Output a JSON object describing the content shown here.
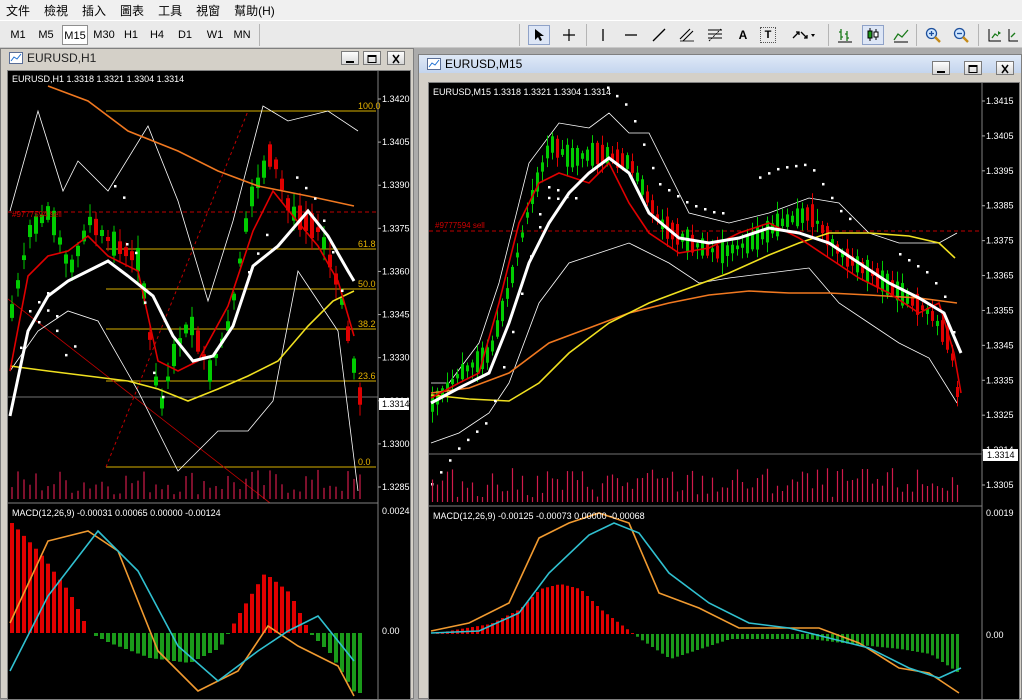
{
  "menu": [
    "文件",
    "檢視",
    "插入",
    "圖表",
    "工具",
    "視窗",
    "幫助(H)"
  ],
  "timeframes": [
    "M1",
    "M5",
    "M15",
    "M30",
    "H1",
    "H4",
    "D1",
    "W1",
    "MN"
  ],
  "active_timeframe": "M15",
  "toolbar_tools": [
    "cursor-arrow",
    "crosshair",
    "vertical-line",
    "horizontal-line",
    "trend-line",
    "equidistant-channel",
    "fibonacci",
    "text-label",
    "text-box",
    "arrows-menu",
    "bar-chart",
    "candlestick-chart",
    "line-chart",
    "zoom-in",
    "zoom-out",
    "chart-shift",
    "auto-scroll"
  ],
  "tools_text": {
    "text_label": "A",
    "text_box": "T"
  },
  "colors": {
    "up": "#00cc00",
    "down": "#e00000",
    "ma_white": "#ffffff",
    "ma_yellow": "#f0e020",
    "ma_orange": "#f07820",
    "ma_red": "#e00000",
    "macd_line": "#f09a30",
    "signal_line": "#30c0d0",
    "volume": "#d01a4a"
  },
  "windows": {
    "h1": {
      "title": "EURUSD,H1",
      "header": "EURUSD,H1  1.3318 1.3321 1.3304 1.3314",
      "order_label": "#9777594 sell",
      "price_axis": [
        "1.3420",
        "1.3405",
        "1.3390",
        "1.3375",
        "1.3360",
        "1.3345",
        "1.3330",
        "1.3314",
        "1.3300",
        "1.3285"
      ],
      "current_price": "1.3314",
      "fib_levels": [
        "100.0",
        "61.8",
        "50.0",
        "38.2",
        "23.6",
        "0.0"
      ],
      "macd_header": "MACD(12,26,9) -0.00031 0.00065 0.00000 -0.00124",
      "macd_axis": [
        "0.00241",
        "0.00"
      ]
    },
    "m15": {
      "title": "EURUSD,M15",
      "header": "EURUSD,M15  1.3318 1.3321 1.3304 1.3314",
      "order_label": "#9777594 sell",
      "price_axis": [
        "1.3415",
        "1.3405",
        "1.3395",
        "1.3385",
        "1.3375",
        "1.3365",
        "1.3355",
        "1.3345",
        "1.3335",
        "1.3325",
        "1.3314",
        "1.3305"
      ],
      "current_price": "1.3314",
      "macd_header": "MACD(12,26,9) -0.00125 -0.00073 0.00000 -0.00068",
      "macd_axis": [
        "0.0019",
        "0.00"
      ]
    }
  }
}
